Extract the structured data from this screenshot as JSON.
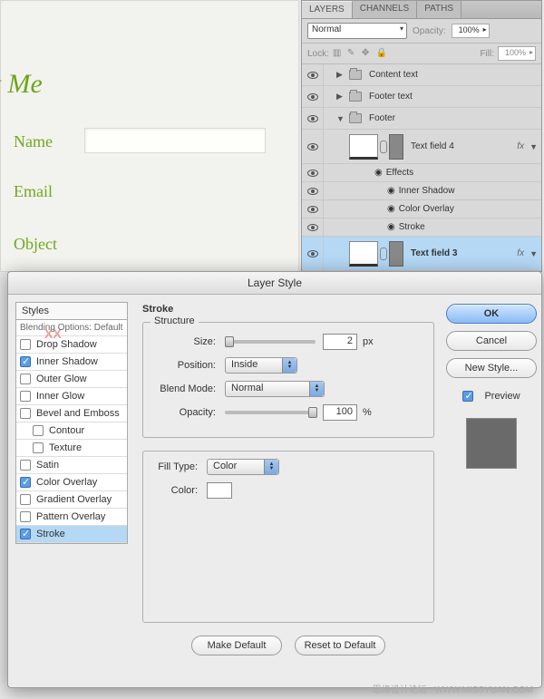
{
  "page": {
    "title": "ntact Me",
    "labels": {
      "name": "Name",
      "email": "Email",
      "object": "Object"
    }
  },
  "layers_panel": {
    "tabs": {
      "layers": "LAYERS",
      "channels": "CHANNELS",
      "paths": "PATHS"
    },
    "blend_mode": "Normal",
    "opacity_label": "Opacity:",
    "opacity_value": "100%",
    "lock_label": "Lock:",
    "fill_label": "Fill:",
    "fill_value": "100%",
    "items": {
      "content_text": "Content text",
      "footer_text": "Footer text",
      "footer": "Footer",
      "text_field_4": "Text field 4",
      "effects": "Effects",
      "inner_shadow": "Inner Shadow",
      "color_overlay": "Color Overlay",
      "stroke": "Stroke",
      "text_field_3": "Text field 3"
    },
    "fx": "fx"
  },
  "dialog": {
    "title": "Layer Style",
    "styles_col": {
      "header": "Styles",
      "blending": "Blending Options: Default",
      "options": {
        "drop_shadow": "Drop Shadow",
        "inner_shadow": "Inner Shadow",
        "outer_glow": "Outer Glow",
        "inner_glow": "Inner Glow",
        "bevel": "Bevel and Emboss",
        "contour": "Contour",
        "texture": "Texture",
        "satin": "Satin",
        "color_overlay": "Color Overlay",
        "gradient_overlay": "Gradient Overlay",
        "pattern_overlay": "Pattern Overlay",
        "stroke": "Stroke"
      }
    },
    "stroke": {
      "group_title": "Stroke",
      "structure_title": "Structure",
      "size_label": "Size:",
      "size_value": "2",
      "size_unit": "px",
      "position_label": "Position:",
      "position_value": "Inside",
      "blend_label": "Blend Mode:",
      "blend_value": "Normal",
      "opacity_label": "Opacity:",
      "opacity_value": "100",
      "opacity_unit": "%",
      "fill_type_label": "Fill Type:",
      "fill_type_value": "Color",
      "color_label": "Color:",
      "make_default": "Make Default",
      "reset_default": "Reset to Default"
    },
    "buttons": {
      "ok": "OK",
      "cancel": "Cancel",
      "new_style": "New Style...",
      "preview": "Preview"
    }
  },
  "watermark": "思缘设计论坛 . WWW.MISSYUAN.COM"
}
